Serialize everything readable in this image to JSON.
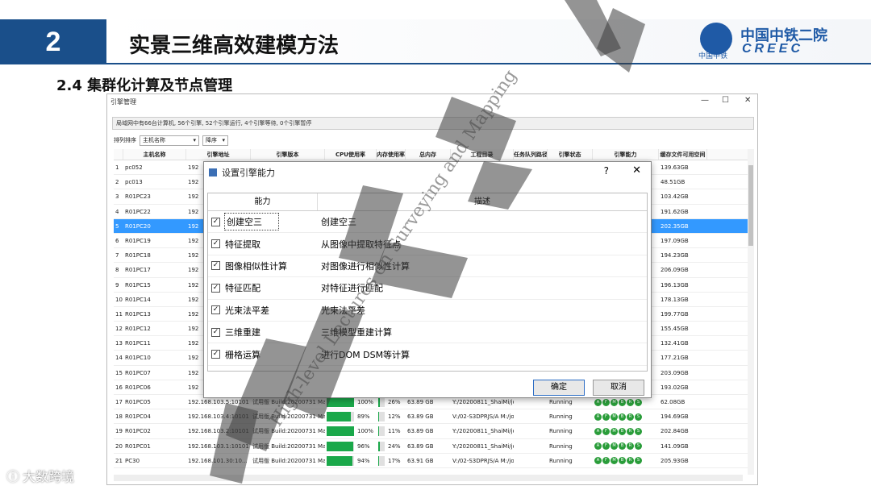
{
  "slide": {
    "number": "2",
    "title": "实景三维高效建模方法",
    "subtitle": "2.4 集群化计算及节点管理",
    "logo_cn": "中国中铁二院",
    "logo_en": "CREEC",
    "logo_small": "中国中铁",
    "brand_color": "#1a4f8a"
  },
  "window": {
    "title": "引擎管理",
    "info": "局域网中有66台计算机, 56个引擎, 52个引擎运行, 4个引擎等待, 0个引擎暂停",
    "sort_label": "排列排序",
    "sort_field": "主机名称",
    "sort_order": "降序",
    "columns": [
      "",
      "主机名称",
      "引擎地址",
      "引擎版本",
      "CPU使用率",
      "内存使用率",
      "总内存",
      "工程目录",
      "任务队列路径",
      "引擎状态",
      "引擎能力",
      "缓存文件可用空间"
    ],
    "rows": [
      {
        "idx": "1",
        "name": "pc052",
        "addr": "192",
        "disk": "139.63GB"
      },
      {
        "idx": "2",
        "name": "pc013",
        "addr": "192",
        "disk": "48.51GB"
      },
      {
        "idx": "3",
        "name": "R01PC23",
        "addr": "192",
        "disk": "103.42GB"
      },
      {
        "idx": "4",
        "name": "R01PC22",
        "addr": "192",
        "disk": "191.62GB"
      },
      {
        "idx": "5",
        "name": "R01PC20",
        "addr": "192",
        "disk": "202.35GB"
      },
      {
        "idx": "6",
        "name": "R01PC19",
        "addr": "192",
        "disk": "197.09GB"
      },
      {
        "idx": "7",
        "name": "R01PC18",
        "addr": "192",
        "disk": "194.23GB"
      },
      {
        "idx": "8",
        "name": "R01PC17",
        "addr": "192",
        "disk": "206.09GB"
      },
      {
        "idx": "9",
        "name": "R01PC15",
        "addr": "192",
        "disk": "196.13GB"
      },
      {
        "idx": "10",
        "name": "R01PC14",
        "addr": "192",
        "disk": "178.13GB"
      },
      {
        "idx": "11",
        "name": "R01PC13",
        "addr": "192",
        "disk": "199.77GB"
      },
      {
        "idx": "12",
        "name": "R01PC12",
        "addr": "192",
        "disk": "155.45GB"
      },
      {
        "idx": "13",
        "name": "R01PC11",
        "addr": "192",
        "disk": "132.41GB"
      },
      {
        "idx": "14",
        "name": "R01PC10",
        "addr": "192",
        "disk": "177.21GB"
      },
      {
        "idx": "15",
        "name": "R01PC07",
        "addr": "192",
        "disk": "203.09GB"
      },
      {
        "idx": "16",
        "name": "R01PC06",
        "addr": "192",
        "disk": "193.02GB"
      },
      {
        "idx": "17",
        "name": "R01PC05",
        "addr": "192.168.103.5:10101",
        "ver": "试用版 Build:20200731 Ma",
        "cpu": "100%",
        "cpu_v": 1.0,
        "mem": "26%",
        "mem_v": 0.26,
        "tot": "63.89 GB",
        "proj": "Y:/20200811_ShaiMi/job-qjj",
        "state": "Running",
        "disk": "62.08GB"
      },
      {
        "idx": "18",
        "name": "R01PC04",
        "addr": "192.168.103.4:10101",
        "ver": "试用版 Build:20200731 Ma",
        "cpu": "89%",
        "cpu_v": 0.89,
        "mem": "12%",
        "mem_v": 0.12,
        "tot": "63.89 GB",
        "proj": "V:/02-S3DPRJS/A M:/job-ncy",
        "state": "Running",
        "disk": "194.69GB"
      },
      {
        "idx": "19",
        "name": "R01PC02",
        "addr": "192.168.103.2:10101",
        "ver": "试用版 Build:20200731 Ma",
        "cpu": "100%",
        "cpu_v": 1.0,
        "mem": "11%",
        "mem_v": 0.11,
        "tot": "63.89 GB",
        "proj": "Y:/20200811_ShaiMi/job-qjj",
        "state": "Running",
        "disk": "202.84GB"
      },
      {
        "idx": "20",
        "name": "R01PC01",
        "addr": "192.168.103.1:10101",
        "ver": "试用版 Build:20200731 Ma",
        "cpu": "96%",
        "cpu_v": 0.96,
        "mem": "24%",
        "mem_v": 0.24,
        "tot": "63.89 GB",
        "proj": "Y:/20200811_ShaiMi/job-qjj",
        "state": "Running",
        "disk": "141.09GB"
      },
      {
        "idx": "21",
        "name": "PC30",
        "addr": "192.168.101.30:10...",
        "ver": "试用版 Build:20200731 Ma",
        "cpu": "94%",
        "cpu_v": 0.94,
        "mem": "17%",
        "mem_v": 0.17,
        "tot": "63.91 GB",
        "proj": "V:/02-S3DPRJS/A M:/job-ncy",
        "state": "Running",
        "disk": "205.93GB"
      }
    ],
    "selected_index": 4,
    "cap_badges": [
      "A",
      "F",
      "M",
      "B",
      "R",
      "S"
    ],
    "cap_color": "#2a9d3a"
  },
  "dialog": {
    "title": "设置引擎能力",
    "help": "?",
    "close": "✕",
    "col_capability": "能力",
    "col_description": "描述",
    "items": [
      {
        "name": "创建空三",
        "desc": "创建空三",
        "checked": true
      },
      {
        "name": "特征提取",
        "desc": "从图像中提取特征点",
        "checked": true
      },
      {
        "name": "图像相似性计算",
        "desc": "对图像进行相似性计算",
        "checked": true
      },
      {
        "name": "特征匹配",
        "desc": "对特征进行匹配",
        "checked": true
      },
      {
        "name": "光束法平差",
        "desc": "光束法平差",
        "checked": true
      },
      {
        "name": "三维重建",
        "desc": "三维模型重建计算",
        "checked": true
      },
      {
        "name": "栅格运算",
        "desc": "进行DOM DSM等计算",
        "checked": true
      }
    ],
    "ok": "确定",
    "cancel": "取消"
  },
  "watermark": {
    "text": "High-level Lectures on Surveying and Mapping",
    "bottom": "大数跨境"
  }
}
